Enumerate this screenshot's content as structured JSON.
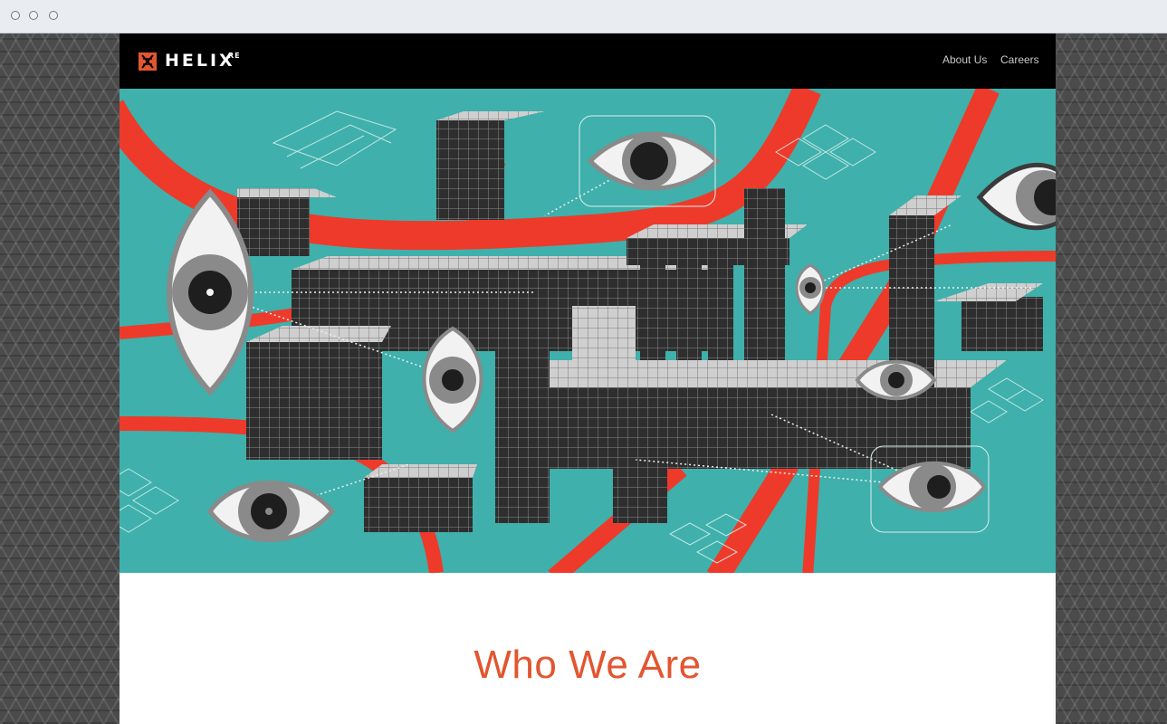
{
  "brand": {
    "name": "HELIX",
    "superscript": "RE",
    "accent_color": "#e2562f",
    "logo_icon": "helix-logo-icon"
  },
  "nav": {
    "items": [
      {
        "label": "About Us"
      },
      {
        "label": "Careers"
      }
    ]
  },
  "hero": {
    "background_color": "#3fb0ab",
    "illustration": "isometric-grid-eyes-illustration"
  },
  "section": {
    "title": "Who We Are"
  }
}
